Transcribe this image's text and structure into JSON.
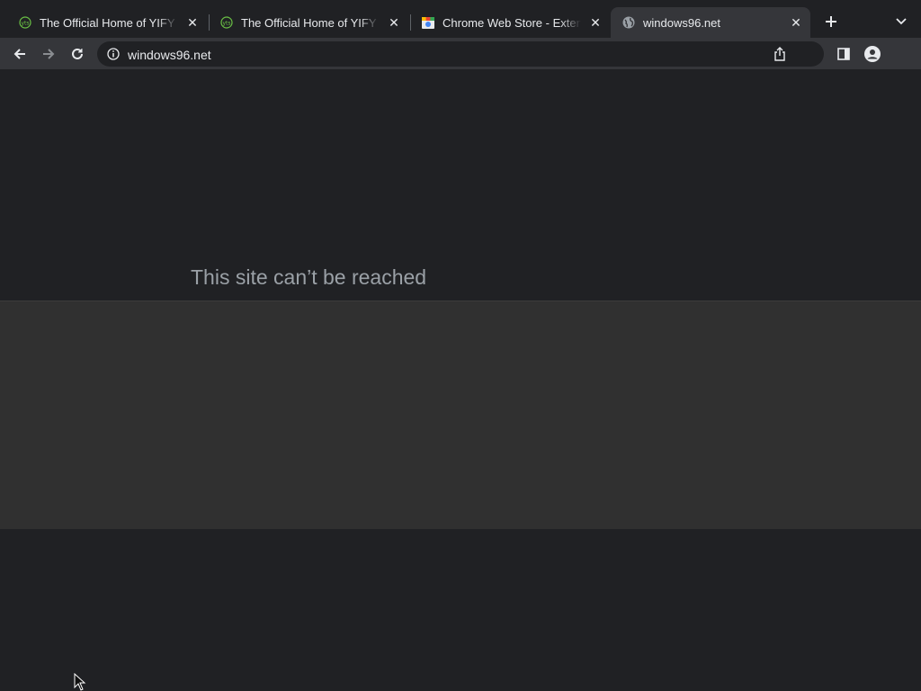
{
  "tabs": [
    {
      "title": "The Official Home of YIFY Movies Torrent Download - YTS",
      "favicon": "yts-icon",
      "active": false
    },
    {
      "title": "The Official Home of YIFY Movies Torrent Download - YTS",
      "favicon": "yts-icon",
      "active": false
    },
    {
      "title": "Chrome Web Store - Extensions",
      "favicon": "chrome-web-store-icon",
      "active": false
    },
    {
      "title": "windows96.net",
      "favicon": "globe-icon",
      "active": true
    }
  ],
  "toolbar": {
    "url": "windows96.net"
  },
  "page": {
    "error_title": "This site can’t be reached"
  },
  "colors": {
    "frame": "#202124",
    "toolbar": "#35363a",
    "active_tab": "#35363a",
    "band": "#303030",
    "error_text": "#9aa0a6"
  }
}
